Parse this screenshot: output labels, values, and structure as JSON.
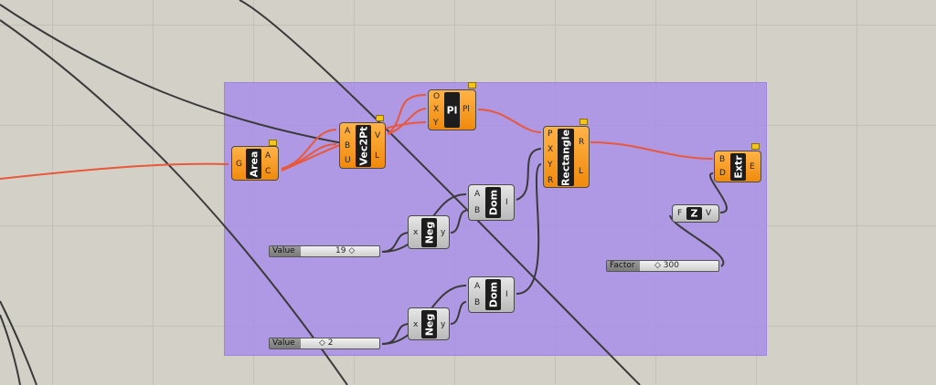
{
  "colors": {
    "group": "#a78cec",
    "wire_dark": "#3a3a3a",
    "wire_red": "#e8583a",
    "component": "#f5941f",
    "param": "#c8c8c8",
    "flag": "#f5c518"
  },
  "nodes": {
    "area": {
      "name": "Area",
      "in": [
        "G"
      ],
      "out": [
        "A",
        "C"
      ]
    },
    "vec2pt": {
      "name": "Vec2Pt",
      "in": [
        "A",
        "B",
        "U"
      ],
      "out": [
        "V",
        "L"
      ]
    },
    "pl": {
      "name": "Pl",
      "in": [
        "O",
        "X",
        "Y"
      ],
      "out": [
        "Pl"
      ]
    },
    "rectangle": {
      "name": "Rectangle",
      "in": [
        "P",
        "X",
        "Y",
        "R"
      ],
      "out": [
        "R",
        "L"
      ]
    },
    "extr": {
      "name": "Extr",
      "in": [
        "B",
        "D"
      ],
      "out": [
        "E"
      ]
    },
    "z": {
      "name": "Z",
      "in": [
        "F"
      ],
      "out": [
        "V"
      ]
    },
    "dom1": {
      "name": "Dom",
      "in": [
        "A",
        "B"
      ],
      "out": [
        "I"
      ]
    },
    "dom2": {
      "name": "Dom",
      "in": [
        "A",
        "B"
      ],
      "out": [
        "I"
      ]
    },
    "neg1": {
      "name": "Neg",
      "in": [
        "x"
      ],
      "out": [
        "y"
      ]
    },
    "neg2": {
      "name": "Neg",
      "in": [
        "x"
      ],
      "out": [
        "y"
      ]
    }
  },
  "sliders": {
    "value1": {
      "label": "Value",
      "value": "19 ◇"
    },
    "value2": {
      "label": "Value",
      "value": "◇ 2"
    },
    "factor": {
      "label": "Factor",
      "value": "◇ 300"
    }
  }
}
